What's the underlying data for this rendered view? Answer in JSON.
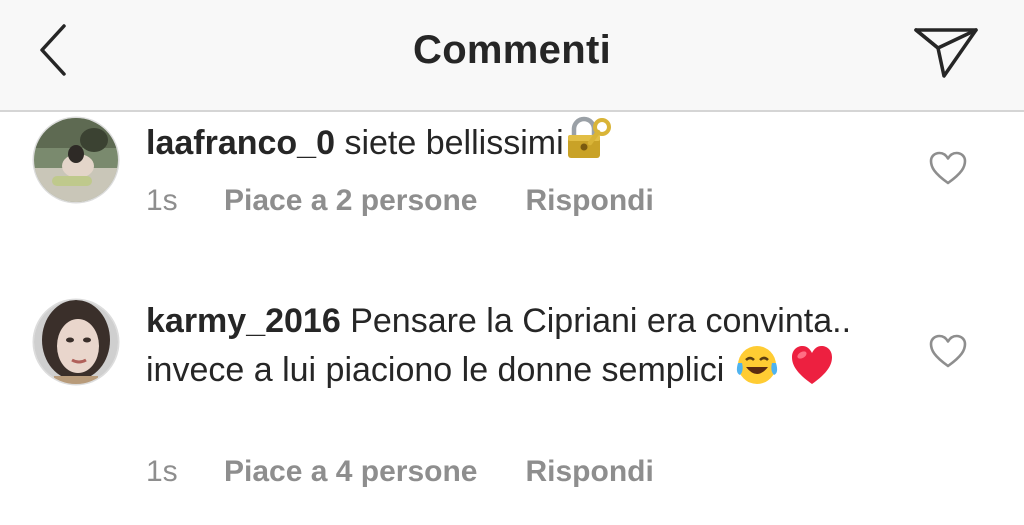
{
  "header": {
    "title": "Commenti",
    "back_icon": "chevron-left-icon",
    "send_icon": "paper-plane-icon"
  },
  "comments": [
    {
      "username": "laafranco_0",
      "text": "siete bellissimi",
      "emoji": [
        "lock-with-key-emoji"
      ],
      "time": "1s",
      "likes": "Piace a 2 persone",
      "reply": "Rispondi"
    },
    {
      "username": "karmy_2016",
      "text": "Pensare la Cipriani era convinta.. invece a lui piaciono le donne semplici",
      "emoji": [
        "tears-of-joy-emoji",
        "red-heart-emoji"
      ],
      "time": "1s",
      "likes": "Piace a 4 persone",
      "reply": "Rispondi"
    }
  ],
  "colors": {
    "header_bg": "#f8f8f8",
    "text": "#262626",
    "meta": "#8e8e8e",
    "heart": "#ed2040"
  }
}
